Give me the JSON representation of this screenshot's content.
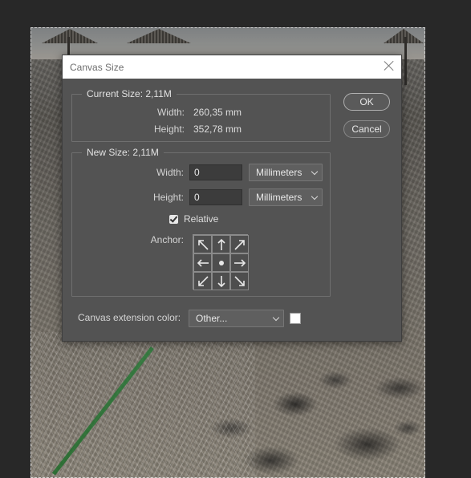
{
  "dialog": {
    "title": "Canvas Size",
    "ok_label": "OK",
    "cancel_label": "Cancel"
  },
  "current_size": {
    "legend": "Current Size: 2,11M",
    "width_label": "Width:",
    "width_value": "260,35 mm",
    "height_label": "Height:",
    "height_value": "352,78 mm"
  },
  "new_size": {
    "legend": "New Size: 2,11M",
    "width_label": "Width:",
    "width_value": "0",
    "width_unit": "Millimeters",
    "height_label": "Height:",
    "height_value": "0",
    "height_unit": "Millimeters",
    "relative_label": "Relative",
    "relative_checked": true,
    "anchor_label": "Anchor:"
  },
  "extension": {
    "label": "Canvas extension color:",
    "value": "Other...",
    "swatch_color": "#ffffff"
  },
  "anchor_icons": [
    "arrow-up-left-icon",
    "arrow-up-icon",
    "arrow-up-right-icon",
    "arrow-left-icon",
    "anchor-dot-icon",
    "arrow-right-icon",
    "arrow-down-left-icon",
    "arrow-down-icon",
    "arrow-down-right-icon"
  ]
}
